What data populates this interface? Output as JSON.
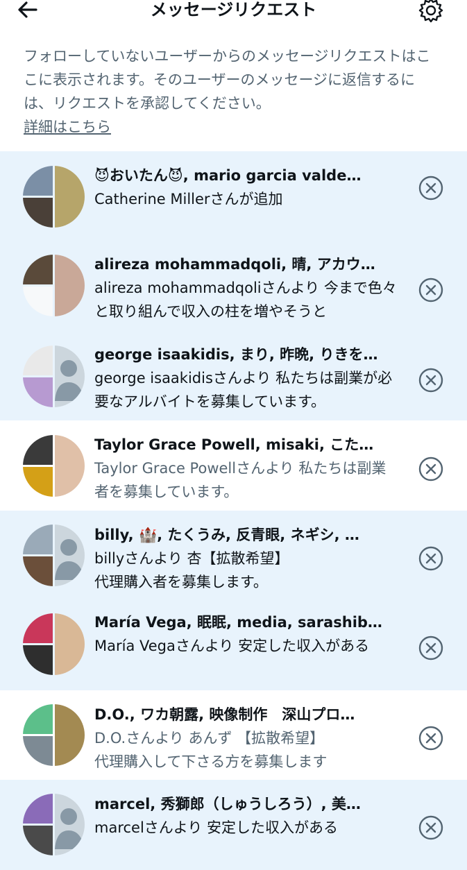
{
  "header": {
    "title": "メッセージリクエスト",
    "back_icon": "back-arrow-icon",
    "settings_icon": "gear-icon"
  },
  "intro": {
    "text": "フォローしていないユーザーからのメッセージリクエストはここに表示されます。そのユーザーのメッセージに返信するには、リクエストを承認してください。",
    "link": "詳細はこちら"
  },
  "requests": [
    {
      "names": "😈おいたん😈, mario garcia valde…",
      "preview": "Catherine Millerさんが追加",
      "unread": true
    },
    {
      "names": "alireza mohammadqoli, 晴, アカウ…",
      "preview": "alireza mohammadqoliさんより 今まで色々と取り組んで収入の柱を増やそうと",
      "unread": true
    },
    {
      "names": "george isaakidis, まり, 昨晩, りきを…",
      "preview": "george isaakidisさんより 私たちは副業が必要なアルバイトを募集しています。",
      "unread": true
    },
    {
      "names": "Taylor Grace Powell, misaki, こた…",
      "preview": "Taylor Grace Powellさんより 私たちは副業者を募集しています。",
      "unread": false
    },
    {
      "names": "billy, 🏰, たくうみ, 反青眼, ネギシ, …",
      "preview": "billyさんより 杏【拡散希望】\n代理購入者を募集します。",
      "unread": true
    },
    {
      "names": "María Vega, 眠眠, media, sarashib…",
      "preview": "María Vegaさんより 安定した収入がある",
      "unread": true
    },
    {
      "names": "D.O., ワカ朝露, 映像制作　深山プロ…",
      "preview": "D.O.さんより あんず 【拡散希望】\n代理購入して下さる方を募集します",
      "unread": false
    },
    {
      "names": "marcel, 秀獅郎（しゅうしろう）, 美…",
      "preview": "marcelさんより 安定した収入がある",
      "unread": true
    }
  ],
  "colors": {
    "unread_bg": "#e8f3fc",
    "secondary_text": "#536471",
    "primary_text": "#0f1419"
  }
}
